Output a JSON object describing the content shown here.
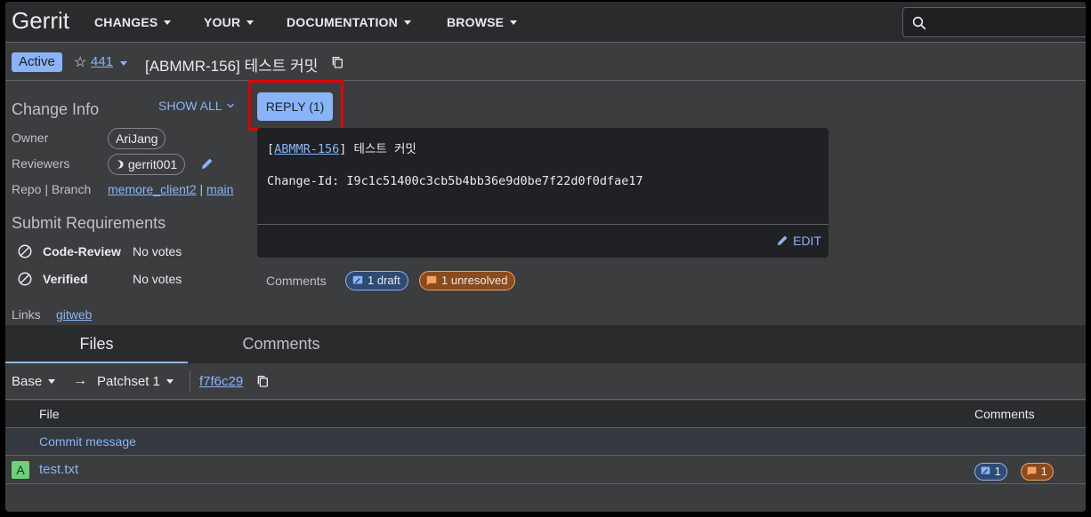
{
  "app": {
    "logo": "Gerrit"
  },
  "nav": {
    "changes": "CHANGES",
    "your": "YOUR",
    "documentation": "DOCUMENTATION",
    "browse": "BROWSE"
  },
  "header": {
    "status": "Active",
    "change_number": "441",
    "subject": "[ABMMR-156] 테스트 커밋"
  },
  "info": {
    "title": "Change Info",
    "show_all": "SHOW ALL",
    "owner_label": "Owner",
    "owner": "AriJang",
    "reviewers_label": "Reviewers",
    "reviewer": "gerrit001",
    "repo_label": "Repo | Branch",
    "repo": "memore_client2",
    "branch_sep": "|",
    "branch": "main"
  },
  "submit": {
    "title": "Submit Requirements",
    "items": [
      {
        "name": "Code-Review",
        "value": "No votes"
      },
      {
        "name": "Verified",
        "value": "No votes"
      }
    ]
  },
  "links": {
    "label": "Links",
    "gitweb": "gitweb"
  },
  "reply": {
    "label": "REPLY (1)"
  },
  "commit_message": {
    "bracket_open": "[",
    "ticket": "ABMMR-156",
    "bracket_rest": "] 테스트 커밋",
    "change_id": "Change-Id: I9c1c51400c3cb5b4bb36e9d0be7f22d0f0dfae17",
    "edit": "EDIT"
  },
  "comments_summary": {
    "label": "Comments",
    "draft": "1 draft",
    "unresolved": "1 unresolved"
  },
  "tabs": {
    "files": "Files",
    "comments": "Comments"
  },
  "patchset": {
    "base": "Base",
    "arrow": "→",
    "patchset": "Patchset 1",
    "commit": "f7f6c29"
  },
  "file_table": {
    "col_file": "File",
    "col_comments": "Comments",
    "commit_row": "Commit message",
    "files": [
      {
        "status": "A",
        "name": "test.txt",
        "drafts": "1",
        "unresolved": "1"
      }
    ]
  },
  "colors": {
    "accent": "#8ab4f8",
    "highlight": "#e00000",
    "added": "#6ed07a"
  }
}
